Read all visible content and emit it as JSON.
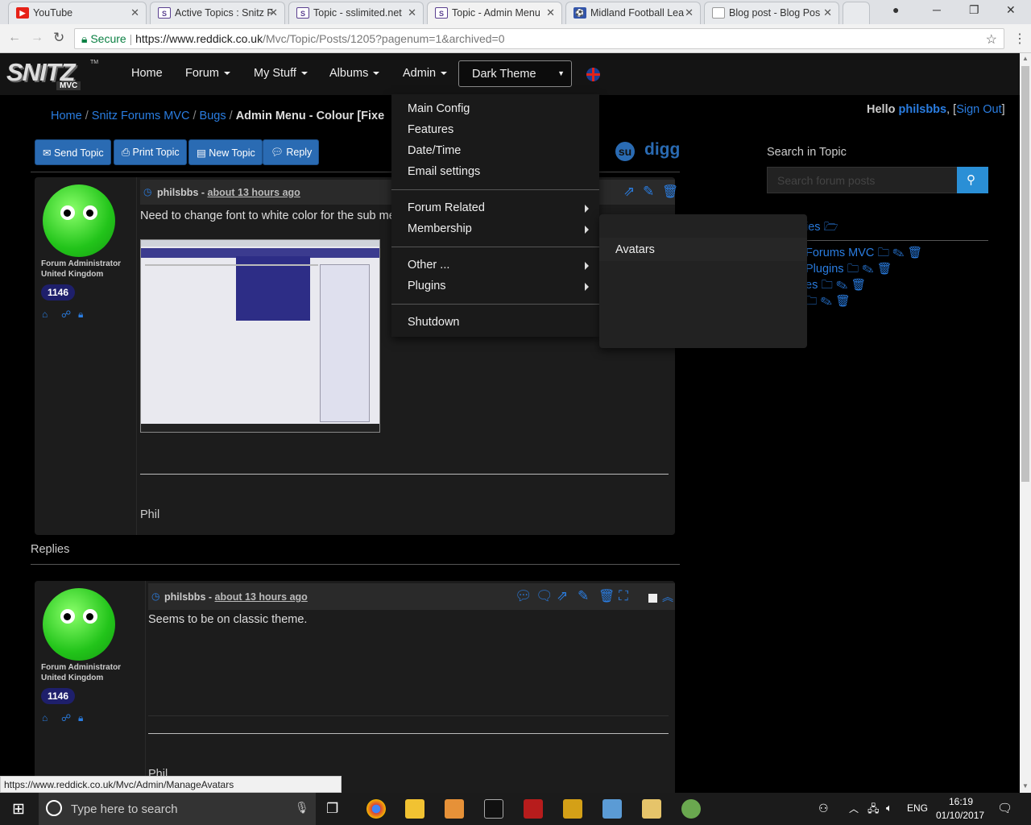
{
  "browser": {
    "tabs": [
      {
        "title": "YouTube",
        "favicon": "youtube-icon",
        "fav_color": "#e62117"
      },
      {
        "title": "Active Topics : Snitz F",
        "favicon": "snitz-icon",
        "fav_color": "#5a3f8f"
      },
      {
        "title": "Topic - sslimited.net",
        "favicon": "snitz-icon",
        "fav_color": "#5a3f8f"
      },
      {
        "title": "Topic - Admin Menu",
        "favicon": "snitz-icon",
        "fav_color": "#5a3f8f"
      },
      {
        "title": "Midland Football Lea",
        "favicon": "football-icon",
        "fav_color": "#3355aa"
      },
      {
        "title": "Blog post - Blog Pos",
        "favicon": "page-icon",
        "fav_color": "#888888"
      }
    ],
    "secure_label": "Secure",
    "url_host": "https://www.reddick.co.uk",
    "url_path": "/Mvc/Topic/Posts/1205?pagenum=1&archived=0",
    "status_url": "https://www.reddick.co.uk/Mvc/Admin/ManageAvatars"
  },
  "nav": {
    "logo": "SNITZ",
    "logo_sub": "MVC",
    "logo_tm": "TM",
    "home": "Home",
    "forum": "Forum",
    "mystuff": "My Stuff",
    "albums": "Albums",
    "admin": "Admin",
    "theme": "Dark Theme"
  },
  "admin_menu": {
    "items1": [
      "Main Config",
      "Features",
      "Date/Time",
      "Email settings"
    ],
    "items2": [
      "Forum Related",
      "Membership"
    ],
    "items3": [
      "Other ...",
      "Plugins"
    ],
    "items4": [
      "Shutdown"
    ],
    "submenu": [
      "Avatars"
    ]
  },
  "breadcrumb": [
    "Home",
    "Snitz Forums MVC",
    "Bugs",
    "Admin Menu - Colour [Fixe"
  ],
  "user": {
    "hello": "Hello",
    "name": "philsbbs",
    "signout": "Sign Out"
  },
  "buttons": [
    "Send Topic",
    "Print Topic",
    "New Topic",
    "Reply"
  ],
  "share": {
    "digg": "digg"
  },
  "search": {
    "label": "Search in Topic",
    "placeholder": "Search forum posts"
  },
  "sidebar_fragments": [
    "ies",
    "Forums MVC",
    "Plugins",
    "es"
  ],
  "posts": [
    {
      "author": "philsbbs",
      "time": "about 13 hours ago",
      "body": "Need to change font to white color for the sub mer",
      "signature": "Phil",
      "role": "Forum Administrator",
      "country": "United Kingdom",
      "count": "1146"
    },
    {
      "author": "philsbbs",
      "time": "about 13 hours ago",
      "body": "Seems to be on classic theme.",
      "signature": "Phil",
      "role": "Forum Administrator",
      "country": "United Kingdom",
      "count": "1146"
    }
  ],
  "replies_label": "Replies",
  "taskbar": {
    "search": "Type here to search",
    "lang": "ENG",
    "time": "16:19",
    "date": "01/10/2017"
  }
}
